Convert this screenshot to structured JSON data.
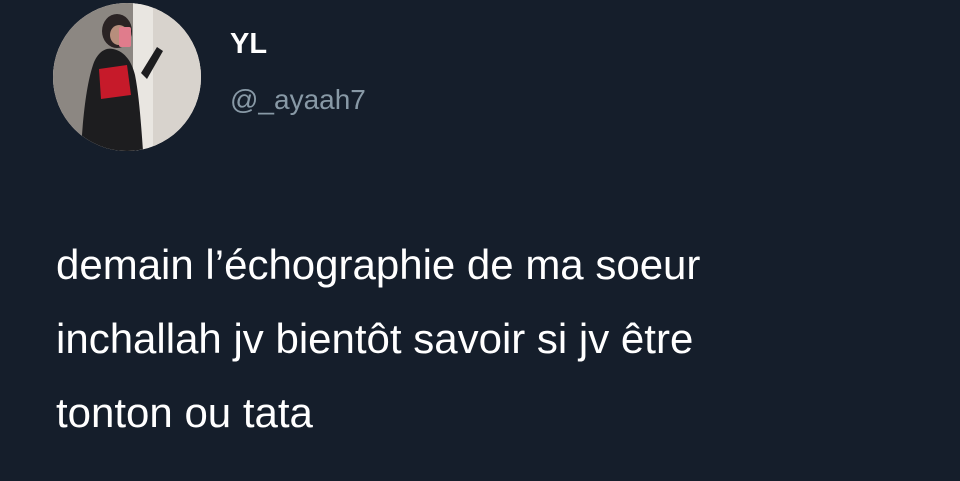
{
  "colors": {
    "background": "#151e2b",
    "name_text": "#ffffff",
    "handle_text": "#8899a6",
    "body_text": "#ffffff"
  },
  "author": {
    "display_name": "YL",
    "handle": "@_ayaah7",
    "avatar_icon": "profile-photo"
  },
  "tweet": {
    "lines": [
      "demain l’échographie de ma soeur",
      "inchallah jv bientôt savoir si jv être",
      "tonton ou tata"
    ]
  }
}
